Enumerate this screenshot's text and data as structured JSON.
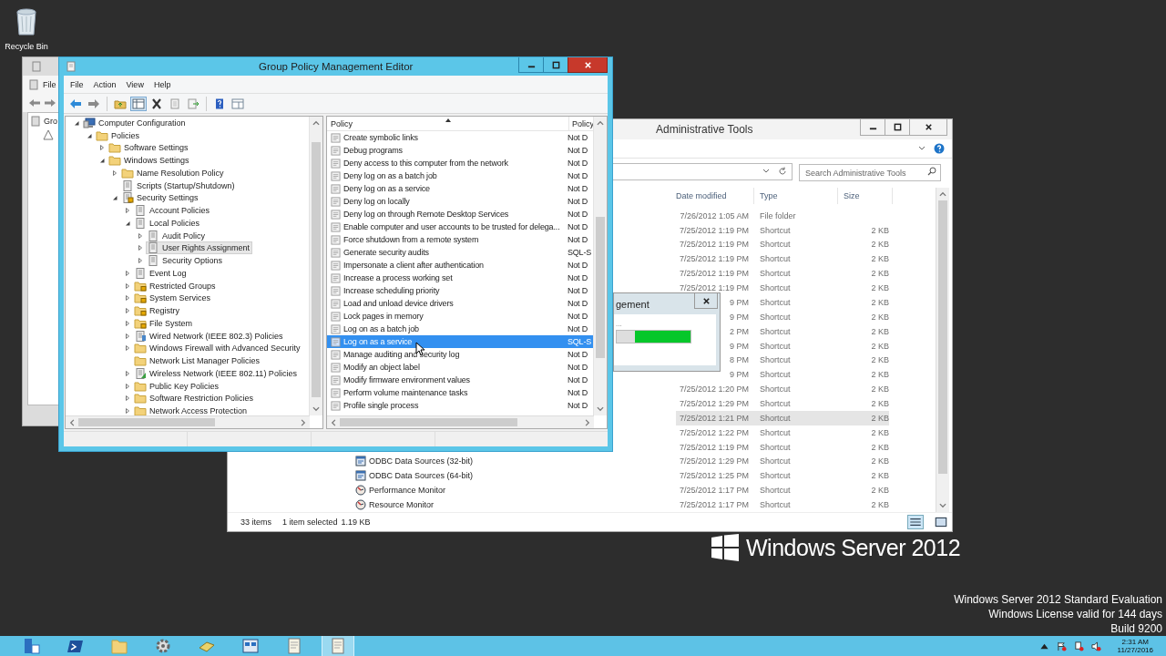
{
  "desktop": {
    "icons": [
      {
        "label": "Recycle Bin"
      }
    ]
  },
  "background_window": {
    "menu": [
      "File"
    ],
    "tree": [
      "Gro"
    ]
  },
  "explorer": {
    "title": "Administrative Tools",
    "search": {
      "placeholder": "Search Administrative Tools"
    },
    "columns": [
      "Date modified",
      "Type",
      "Size"
    ],
    "rows": [
      {
        "date": "7/26/2012 1:05 AM",
        "type": "File folder",
        "selected": false
      },
      {
        "date": "7/25/2012 1:19 PM",
        "type": "Shortcut",
        "size": "2 KB",
        "selected": false
      },
      {
        "date": "7/25/2012 1:19 PM",
        "type": "Shortcut",
        "size": "2 KB",
        "selected": false
      },
      {
        "date": "7/25/2012 1:19 PM",
        "type": "Shortcut",
        "size": "2 KB",
        "selected": false
      },
      {
        "date": "7/25/2012 1:19 PM",
        "type": "Shortcut",
        "size": "2 KB",
        "selected": false
      },
      {
        "date": "7/25/2012 1:19 PM",
        "type": "Shortcut",
        "size": "2 KB",
        "selected": false
      },
      {
        "date": "9 PM",
        "type": "Shortcut",
        "size": "2 KB",
        "selected": false
      },
      {
        "date": "9 PM",
        "type": "Shortcut",
        "size": "2 KB",
        "selected": false
      },
      {
        "date": "2 PM",
        "type": "Shortcut",
        "size": "2 KB",
        "selected": false
      },
      {
        "date": "9 PM",
        "type": "Shortcut",
        "size": "2 KB",
        "selected": false
      },
      {
        "date": "8 PM",
        "type": "Shortcut",
        "size": "2 KB",
        "selected": false
      },
      {
        "date": "9 PM",
        "type": "Shortcut",
        "size": "2 KB",
        "selected": false
      },
      {
        "date": "7/25/2012 1:20 PM",
        "type": "Shortcut",
        "size": "2 KB",
        "selected": false
      },
      {
        "date": "7/25/2012 1:29 PM",
        "type": "Shortcut",
        "size": "2 KB",
        "selected": false
      },
      {
        "date": "7/25/2012 1:21 PM",
        "type": "Shortcut",
        "size": "2 KB",
        "selected": true
      },
      {
        "date": "7/25/2012 1:22 PM",
        "type": "Shortcut",
        "size": "2 KB",
        "selected": false
      },
      {
        "date": "7/25/2012 1:19 PM",
        "type": "Shortcut",
        "size": "2 KB",
        "selected": false
      },
      {
        "name": "ODBC Data Sources (32-bit)",
        "kind": "odbc",
        "date": "7/25/2012 1:29 PM",
        "type": "Shortcut",
        "size": "2 KB",
        "selected": false
      },
      {
        "name": "ODBC Data Sources (64-bit)",
        "kind": "odbc",
        "date": "7/25/2012 1:25 PM",
        "type": "Shortcut",
        "size": "2 KB",
        "selected": false
      },
      {
        "name": "Performance Monitor",
        "kind": "monitor",
        "date": "7/25/2012 1:17 PM",
        "type": "Shortcut",
        "size": "2 KB",
        "selected": false
      },
      {
        "name": "Resource Monitor",
        "kind": "monitor",
        "date": "7/25/2012 1:17 PM",
        "type": "Shortcut",
        "size": "2 KB",
        "selected": false
      }
    ],
    "status": {
      "items": "33 items",
      "selection": "1 item selected",
      "size": "1.19 KB"
    }
  },
  "progress_dialog": {
    "title": "gement",
    "message": "...",
    "level": 0.75
  },
  "gpme": {
    "title": "Group Policy Management Editor",
    "menu": [
      "File",
      "Action",
      "View",
      "Help"
    ],
    "tree": [
      {
        "label": "Computer Configuration",
        "kind": "computer",
        "expandable": true,
        "expanded": true,
        "selected": false,
        "children": [
          {
            "label": "Policies",
            "kind": "folder",
            "expandable": true,
            "expanded": true,
            "selected": false,
            "children": [
              {
                "label": "Software Settings",
                "kind": "folder",
                "expandable": true,
                "expanded": false,
                "selected": false
              },
              {
                "label": "Windows Settings",
                "kind": "folder",
                "expandable": true,
                "expanded": true,
                "selected": false,
                "children": [
                  {
                    "label": "Name Resolution Policy",
                    "kind": "folder",
                    "expandable": true,
                    "expanded": false,
                    "selected": false
                  },
                  {
                    "label": "Scripts (Startup/Shutdown)",
                    "kind": "script",
                    "expandable": false,
                    "selected": false
                  },
                  {
                    "label": "Security Settings",
                    "kind": "security",
                    "expandable": true,
                    "expanded": true,
                    "selected": false,
                    "children": [
                      {
                        "label": "Account Policies",
                        "kind": "policy",
                        "expandable": true,
                        "expanded": false,
                        "selected": false
                      },
                      {
                        "label": "Local Policies",
                        "kind": "policy",
                        "expandable": true,
                        "expanded": true,
                        "selected": false,
                        "children": [
                          {
                            "label": "Audit Policy",
                            "kind": "policy",
                            "expandable": true,
                            "expanded": false,
                            "selected": false
                          },
                          {
                            "label": "User Rights Assignment",
                            "kind": "policy",
                            "expandable": true,
                            "expanded": false,
                            "selected": true
                          },
                          {
                            "label": "Security Options",
                            "kind": "policy",
                            "expandable": true,
                            "expanded": false,
                            "selected": false
                          }
                        ]
                      },
                      {
                        "label": "Event Log",
                        "kind": "policy",
                        "expandable": true,
                        "expanded": false,
                        "selected": false
                      },
                      {
                        "label": "Restricted Groups",
                        "kind": "locked-folder",
                        "expandable": true,
                        "expanded": false,
                        "selected": false
                      },
                      {
                        "label": "System Services",
                        "kind": "locked-folder",
                        "expandable": true,
                        "expanded": false,
                        "selected": false
                      },
                      {
                        "label": "Registry",
                        "kind": "locked-folder",
                        "expandable": true,
                        "expanded": false,
                        "selected": false
                      },
                      {
                        "label": "File System",
                        "kind": "locked-folder",
                        "expandable": true,
                        "expanded": false,
                        "selected": false
                      },
                      {
                        "label": "Wired Network (IEEE 802.3) Policies",
                        "kind": "network",
                        "expandable": true,
                        "expanded": false,
                        "selected": false
                      },
                      {
                        "label": "Windows Firewall with Advanced Security",
                        "kind": "folder",
                        "expandable": true,
                        "expanded": false,
                        "selected": false
                      },
                      {
                        "label": "Network List Manager Policies",
                        "kind": "folder",
                        "expandable": false,
                        "selected": false
                      },
                      {
                        "label": "Wireless Network (IEEE 802.11) Policies",
                        "kind": "wireless",
                        "expandable": true,
                        "expanded": false,
                        "selected": false
                      },
                      {
                        "label": "Public Key Policies",
                        "kind": "folder",
                        "expandable": true,
                        "expanded": false,
                        "selected": false
                      },
                      {
                        "label": "Software Restriction Policies",
                        "kind": "folder",
                        "expandable": true,
                        "expanded": false,
                        "selected": false
                      },
                      {
                        "label": "Network Access Protection",
                        "kind": "folder",
                        "expandable": true,
                        "expanded": false,
                        "selected": false
                      }
                    ]
                  }
                ]
              }
            ]
          }
        ]
      }
    ],
    "policy_columns": [
      "Policy",
      "Policy"
    ],
    "policies": [
      {
        "name": "Create symbolic links",
        "setting": "Not D",
        "selected": false
      },
      {
        "name": "Debug programs",
        "setting": "Not D",
        "selected": false
      },
      {
        "name": "Deny access to this computer from the network",
        "setting": "Not D",
        "selected": false
      },
      {
        "name": "Deny log on as a batch job",
        "setting": "Not D",
        "selected": false
      },
      {
        "name": "Deny log on as a service",
        "setting": "Not D",
        "selected": false
      },
      {
        "name": "Deny log on locally",
        "setting": "Not D",
        "selected": false
      },
      {
        "name": "Deny log on through Remote Desktop Services",
        "setting": "Not D",
        "selected": false
      },
      {
        "name": "Enable computer and user accounts to be trusted for delega...",
        "setting": "Not D",
        "selected": false
      },
      {
        "name": "Force shutdown from a remote system",
        "setting": "Not D",
        "selected": false
      },
      {
        "name": "Generate security audits",
        "setting": "SQL-S",
        "selected": false
      },
      {
        "name": "Impersonate a client after authentication",
        "setting": "Not D",
        "selected": false
      },
      {
        "name": "Increase a process working set",
        "setting": "Not D",
        "selected": false
      },
      {
        "name": "Increase scheduling priority",
        "setting": "Not D",
        "selected": false
      },
      {
        "name": "Load and unload device drivers",
        "setting": "Not D",
        "selected": false
      },
      {
        "name": "Lock pages in memory",
        "setting": "Not D",
        "selected": false
      },
      {
        "name": "Log on as a batch job",
        "setting": "Not D",
        "selected": false
      },
      {
        "name": "Log on as a service",
        "setting": "SQL-S",
        "selected": true
      },
      {
        "name": "Manage auditing and security log",
        "setting": "Not D",
        "selected": false
      },
      {
        "name": "Modify an object label",
        "setting": "Not D",
        "selected": false
      },
      {
        "name": "Modify firmware environment values",
        "setting": "Not D",
        "selected": false
      },
      {
        "name": "Perform volume maintenance tasks",
        "setting": "Not D",
        "selected": false
      },
      {
        "name": "Profile single process",
        "setting": "Not D",
        "selected": false
      }
    ]
  },
  "branding": {
    "product": "Windows Server 2012"
  },
  "watermark_lines": [
    "Windows Server 2012 Standard Evaluation",
    "Windows License valid for 144 days",
    "Build 9200"
  ],
  "taskbar": {
    "apps": [
      {
        "kind": "server",
        "active": false
      },
      {
        "kind": "terminal",
        "active": false
      },
      {
        "kind": "folder",
        "active": false
      },
      {
        "kind": "gear",
        "active": false
      },
      {
        "kind": "book",
        "active": false
      },
      {
        "kind": "panel",
        "active": false
      },
      {
        "kind": "scroll",
        "active": false
      },
      {
        "kind": "scroll",
        "active": true
      }
    ],
    "clock": {
      "time": "2:31 AM",
      "date": "11/27/2016"
    }
  }
}
